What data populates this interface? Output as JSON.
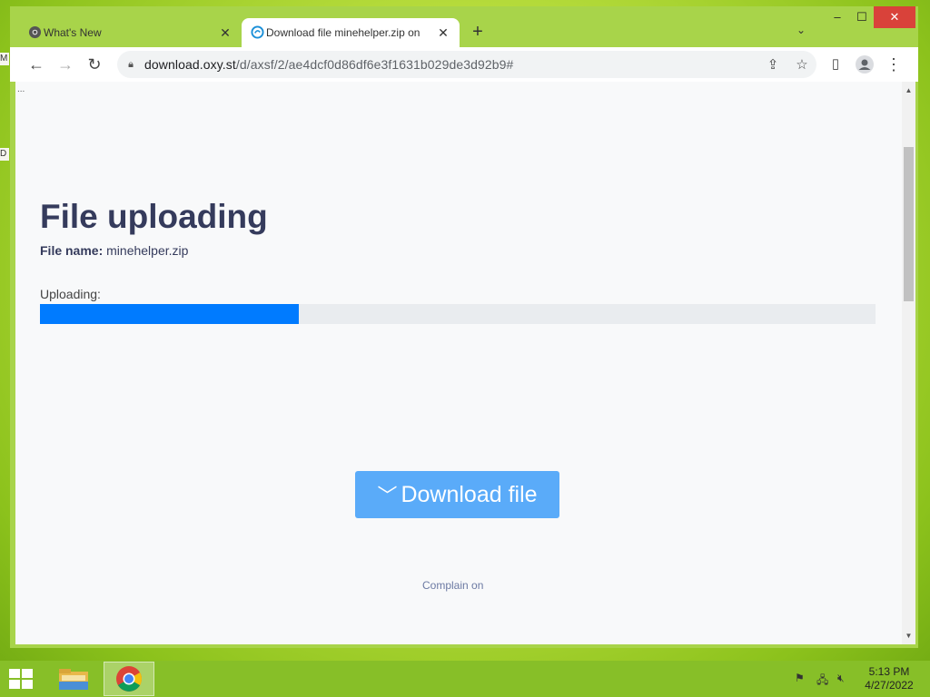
{
  "browser": {
    "tabs": [
      {
        "title": "What's New",
        "active": false,
        "icon": "chrome-icon"
      },
      {
        "title": "Download file minehelper.zip on",
        "active": true,
        "icon": "oxy-icon"
      }
    ],
    "url_host": "download.oxy.st",
    "url_path": "/d/axsf/2/ae4dcf0d86df6e3f1631b029de3d92b9#"
  },
  "page": {
    "ellipsis": "...",
    "title": "File uploading",
    "file_name_label": "File name:",
    "file_name": "minehelper.zip",
    "uploading_label": "Uploading:",
    "progress_fraction": 0.31,
    "download_button": "Download file",
    "complain_link": "Complain on"
  },
  "desktop": {
    "fragments": [
      "M",
      "D"
    ]
  },
  "taskbar": {
    "time": "5:13 PM",
    "date": "4/27/2022"
  },
  "colors": {
    "progress": "#007bff",
    "download_button": "#5aabf9",
    "title": "#353b5c",
    "taskbar": "#87bf28",
    "close_button": "#d9423a"
  }
}
